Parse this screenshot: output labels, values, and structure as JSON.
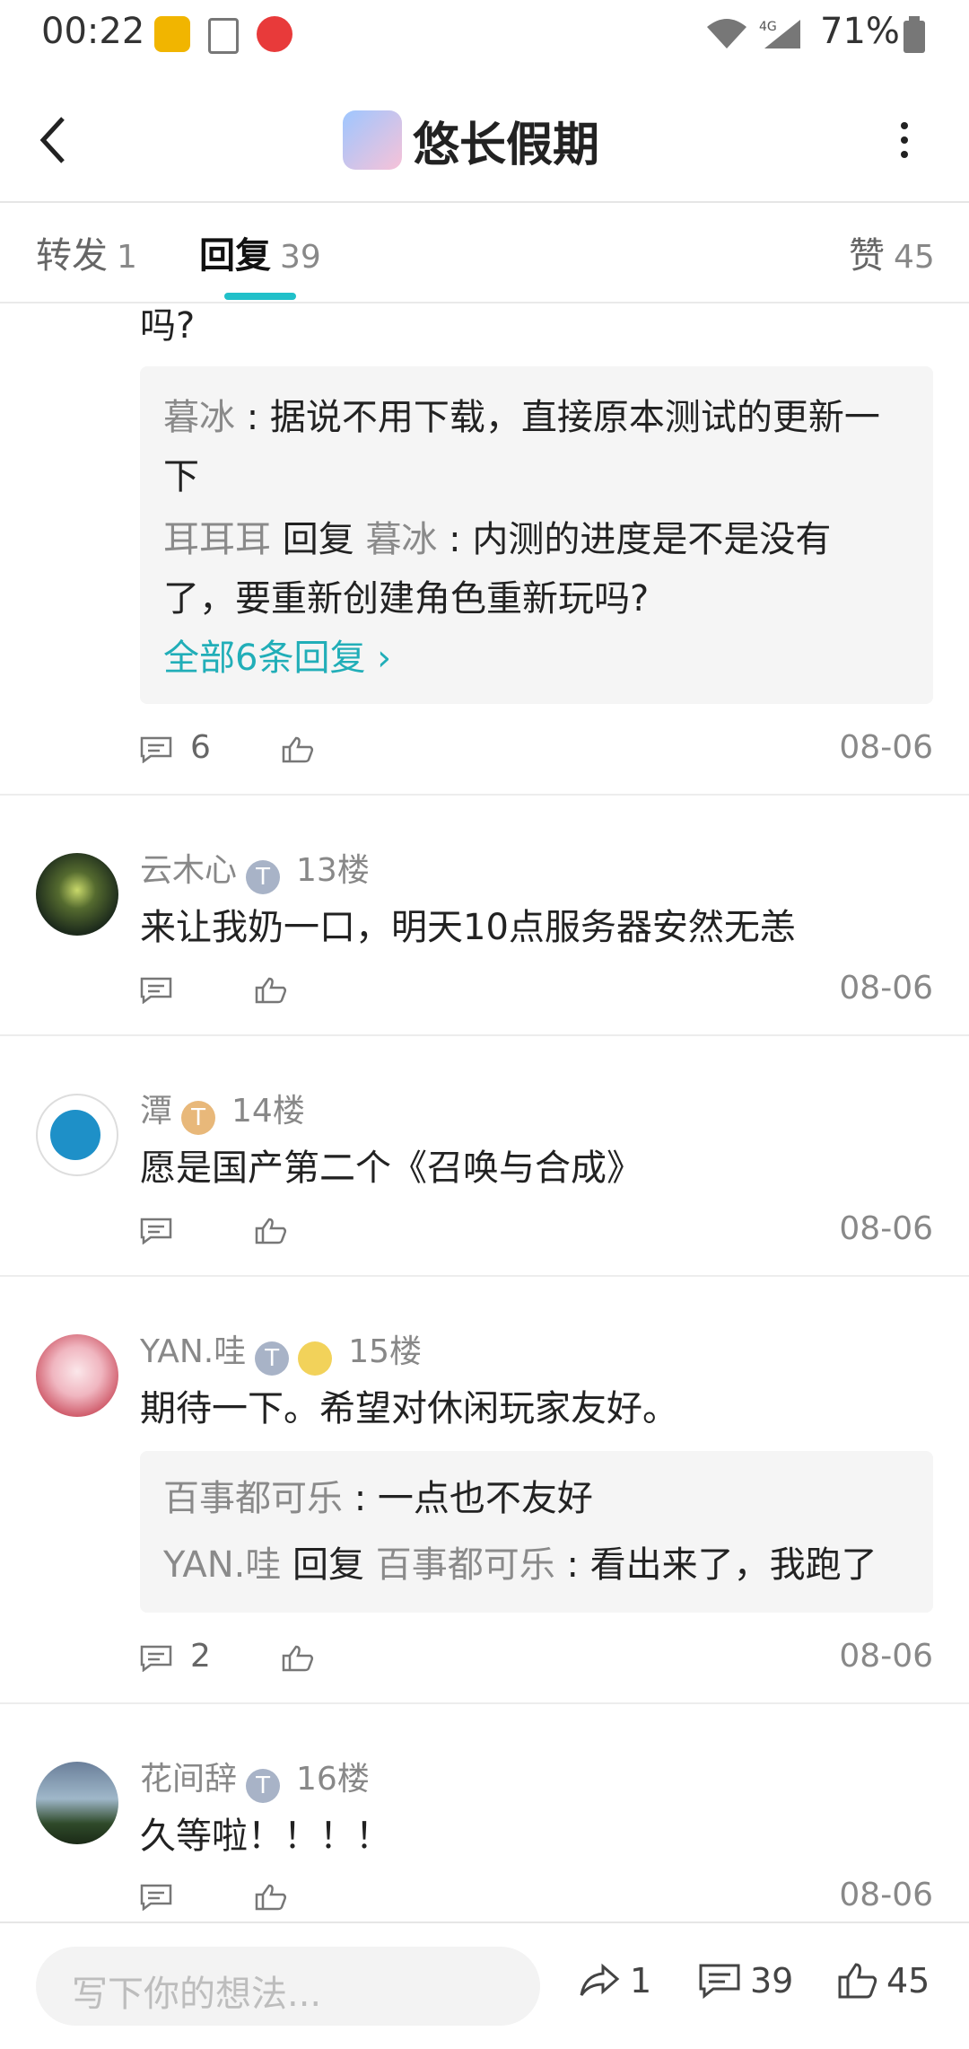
{
  "status_bar": {
    "time": "00:22",
    "battery": "71%"
  },
  "header": {
    "title": "悠长假期"
  },
  "tabs": [
    {
      "label": "转发",
      "count": "1"
    },
    {
      "label": "回复",
      "count": "39"
    },
    {
      "label": "赞",
      "count": "45"
    }
  ],
  "thread": {
    "partial_text": "吗?",
    "replies": [
      {
        "user": "暮冰",
        "sep": " : ",
        "text": "据说不用下载，直接原本测试的更新一",
        "text2": "下"
      },
      {
        "user": "耳耳耳",
        "reply_word": " 回复 ",
        "target": "暮冰",
        "sep": " : ",
        "text": "内测的进度是不是没有",
        "text2": "了，要重新创建角色重新玩吗?"
      }
    ],
    "more_link": "全部6条回复 ›",
    "comment_count": "6",
    "date": "08-06"
  },
  "comments": [
    {
      "user": "云木心",
      "badge": "T",
      "floor": "13楼",
      "text": "来让我奶一口，明天10点服务器安然无恙",
      "date": "08-06"
    },
    {
      "user": "潭",
      "badge": "T",
      "floor": "14楼",
      "text": "愿是国产第二个《召唤与合成》",
      "date": "08-06"
    },
    {
      "user": "YAN.哇",
      "badge": "T",
      "floor": "15楼",
      "text": "期待一下。希望对休闲玩家友好。",
      "replies": [
        {
          "user": "百事都可乐",
          "sep": " : ",
          "text": "一点也不友好"
        },
        {
          "user": "YAN.哇",
          "reply_word": " 回复 ",
          "target": "百事都可乐",
          "sep": " : ",
          "text": "看出来了，我跑了"
        }
      ],
      "comment_count": "2",
      "date": "08-06"
    },
    {
      "user": "花间辞",
      "badge": "T",
      "floor": "16楼",
      "text": "久等啦！！！！",
      "date": "08-06"
    }
  ],
  "bottom_bar": {
    "placeholder": "写下你的想法...",
    "share_count": "1",
    "comment_count": "39",
    "like_count": "45"
  },
  "colors": {
    "accent": "#21c0c9",
    "link": "#21aeb8",
    "muted": "#8a8a8a"
  }
}
